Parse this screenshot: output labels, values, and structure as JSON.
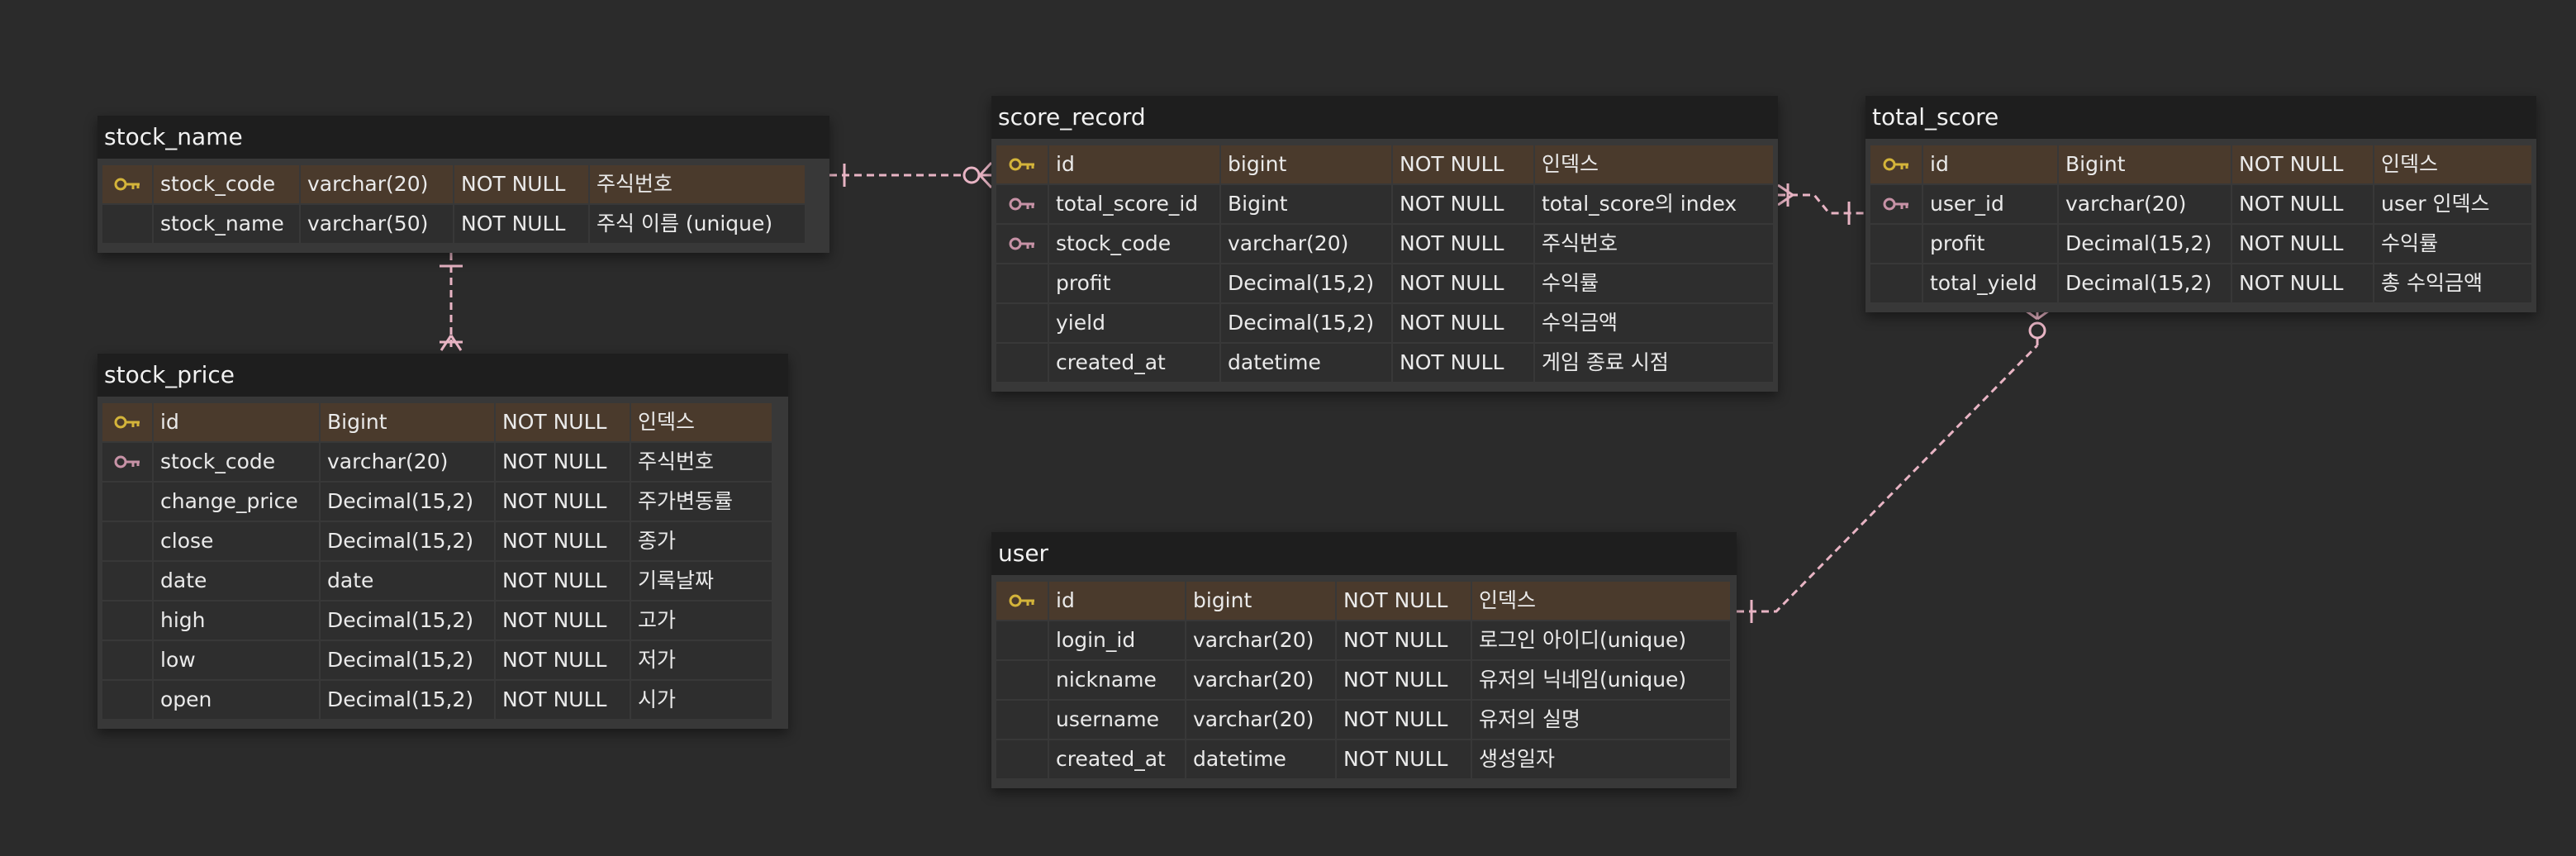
{
  "colors": {
    "background": "#2b2b2b",
    "table_header": "#1e1e1e",
    "table_body": "#383838",
    "cell": "#2e2e2e",
    "pk_row": "#4a3a2c",
    "primary_key_icon": "#d4b43a",
    "foreign_key_icon": "#c792a6",
    "relation_line": "#e8b4c4",
    "text": "#eaeaea"
  },
  "tables": {
    "stock_name": {
      "title": "stock_name",
      "rows": [
        {
          "key": "primary-key",
          "name": "stock_code",
          "type": "varchar(20)",
          "nullable": "NOT NULL",
          "comment": "주식번호"
        },
        {
          "key": "",
          "name": "stock_name",
          "type": "varchar(50)",
          "nullable": "NOT NULL",
          "comment": "주식 이름 (unique)"
        }
      ]
    },
    "stock_price": {
      "title": "stock_price",
      "rows": [
        {
          "key": "primary-key",
          "name": "id",
          "type": "Bigint",
          "nullable": "NOT NULL",
          "comment": "인덱스"
        },
        {
          "key": "foreign-key",
          "name": "stock_code",
          "type": "varchar(20)",
          "nullable": "NOT NULL",
          "comment": "주식번호"
        },
        {
          "key": "",
          "name": "change_price",
          "type": "Decimal(15,2)",
          "nullable": "NOT NULL",
          "comment": "주가변동률"
        },
        {
          "key": "",
          "name": "close",
          "type": "Decimal(15,2)",
          "nullable": "NOT NULL",
          "comment": "종가"
        },
        {
          "key": "",
          "name": "date",
          "type": "date",
          "nullable": "NOT NULL",
          "comment": "기록날짜"
        },
        {
          "key": "",
          "name": "high",
          "type": "Decimal(15,2)",
          "nullable": "NOT NULL",
          "comment": "고가"
        },
        {
          "key": "",
          "name": "low",
          "type": "Decimal(15,2)",
          "nullable": "NOT NULL",
          "comment": "저가"
        },
        {
          "key": "",
          "name": "open",
          "type": "Decimal(15,2)",
          "nullable": "NOT NULL",
          "comment": "시가"
        }
      ]
    },
    "score_record": {
      "title": "score_record",
      "rows": [
        {
          "key": "primary-key",
          "name": "id",
          "type": "bigint",
          "nullable": "NOT NULL",
          "comment": "인덱스"
        },
        {
          "key": "foreign-key",
          "name": "total_score_id",
          "type": "Bigint",
          "nullable": "NOT NULL",
          "comment": "total_score의 index"
        },
        {
          "key": "foreign-key",
          "name": "stock_code",
          "type": "varchar(20)",
          "nullable": "NOT NULL",
          "comment": "주식번호"
        },
        {
          "key": "",
          "name": "profit",
          "type": "Decimal(15,2)",
          "nullable": "NOT NULL",
          "comment": "수익률"
        },
        {
          "key": "",
          "name": "yield",
          "type": "Decimal(15,2)",
          "nullable": "NOT NULL",
          "comment": "수익금액"
        },
        {
          "key": "",
          "name": "created_at",
          "type": "datetime",
          "nullable": "NOT NULL",
          "comment": "게임 종료 시점"
        }
      ]
    },
    "total_score": {
      "title": "total_score",
      "rows": [
        {
          "key": "primary-key",
          "name": "id",
          "type": "Bigint",
          "nullable": "NOT NULL",
          "comment": "인덱스"
        },
        {
          "key": "foreign-key",
          "name": "user_id",
          "type": "varchar(20)",
          "nullable": "NOT NULL",
          "comment": "user 인덱스"
        },
        {
          "key": "",
          "name": "profit",
          "type": "Decimal(15,2)",
          "nullable": "NOT NULL",
          "comment": "수익률"
        },
        {
          "key": "",
          "name": "total_yield",
          "type": "Decimal(15,2)",
          "nullable": "NOT NULL",
          "comment": "총 수익금액"
        }
      ]
    },
    "user": {
      "title": "user",
      "rows": [
        {
          "key": "primary-key",
          "name": "id",
          "type": "bigint",
          "nullable": "NOT NULL",
          "comment": "인덱스"
        },
        {
          "key": "",
          "name": "login_id",
          "type": "varchar(20)",
          "nullable": "NOT NULL",
          "comment": "로그인 아이디(unique)"
        },
        {
          "key": "",
          "name": "nickname",
          "type": "varchar(20)",
          "nullable": "NOT NULL",
          "comment": "유저의 닉네임(unique)"
        },
        {
          "key": "",
          "name": "username",
          "type": "varchar(20)",
          "nullable": "NOT NULL",
          "comment": "유저의 실명"
        },
        {
          "key": "",
          "name": "created_at",
          "type": "datetime",
          "nullable": "NOT NULL",
          "comment": "생성일자"
        }
      ]
    }
  },
  "relations": [
    {
      "from": "stock_name",
      "to": "score_record",
      "from_end": "one",
      "to_end": "zero-or-many"
    },
    {
      "from": "stock_name",
      "to": "stock_price",
      "from_end": "one",
      "to_end": "many"
    },
    {
      "from": "total_score",
      "to": "score_record",
      "from_end": "one",
      "to_end": "many"
    },
    {
      "from": "user",
      "to": "total_score",
      "from_end": "one",
      "to_end": "zero-or-many"
    }
  ]
}
